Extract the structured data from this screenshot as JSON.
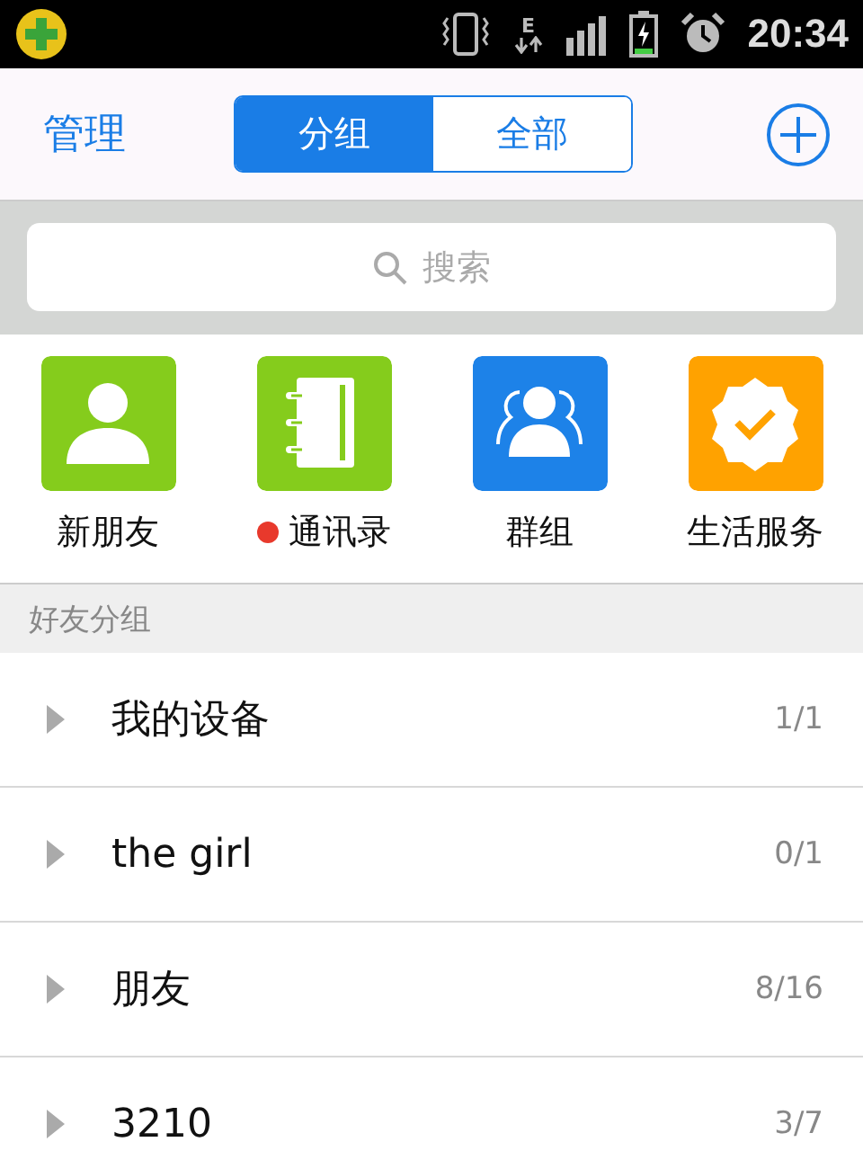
{
  "status_bar": {
    "network": "E",
    "time": "20:34"
  },
  "header": {
    "left": "管理",
    "tabs": [
      {
        "label": "分组",
        "selected": true
      },
      {
        "label": "全部",
        "selected": false
      }
    ]
  },
  "search": {
    "placeholder": "搜索"
  },
  "shortcuts": [
    {
      "label": "新朋友",
      "kind": "person",
      "color": "#85cc1c",
      "dot": false
    },
    {
      "label": "通讯录",
      "kind": "book",
      "color": "#85cc1c",
      "dot": true
    },
    {
      "label": "群组",
      "kind": "group",
      "color": "#1d82e8",
      "dot": false
    },
    {
      "label": "生活服务",
      "kind": "badge",
      "color": "#ffa200",
      "dot": false
    }
  ],
  "section": {
    "title": "好友分组"
  },
  "groups": [
    {
      "name": "我的设备",
      "count": "1/1",
      "expanded": false
    },
    {
      "name": "the girl",
      "count": "0/1",
      "expanded": false
    },
    {
      "name": "朋友",
      "count": "8/16",
      "expanded": false
    },
    {
      "name": "3210",
      "count": "3/7",
      "expanded": false
    }
  ]
}
